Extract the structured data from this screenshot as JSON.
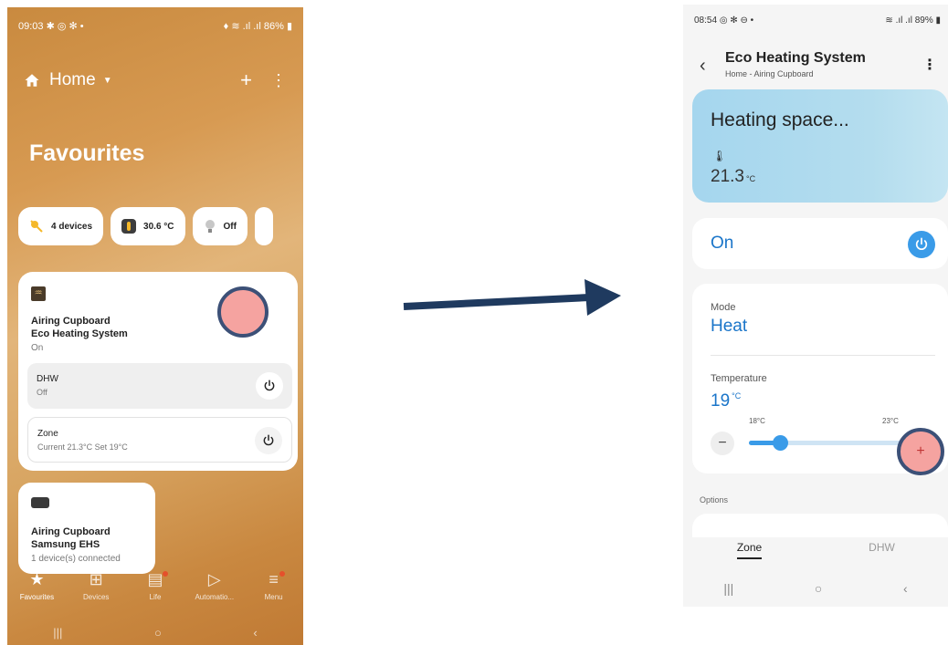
{
  "left": {
    "status": {
      "time": "09:03",
      "left_icons": "✱ ◎ ✻ •",
      "battery": "86%",
      "right_icons": "♦ ≋ .ıl .ıl"
    },
    "header": {
      "title": "Home",
      "add": "+",
      "more": "⋮"
    },
    "favourites_title": "Favourites",
    "chips": [
      {
        "label": "4 devices",
        "icon": "cloud-sun-icon",
        "color": "#f5b829"
      },
      {
        "label": "30.6 °C",
        "icon": "thermometer-icon",
        "color": "#f5b829"
      },
      {
        "label": "Off",
        "icon": "bulb-icon",
        "color": "#c7c7c7"
      }
    ],
    "card1": {
      "room": "Airing Cupboard",
      "device": "Eco Heating System",
      "state": "On",
      "rows": [
        {
          "title": "DHW",
          "subtitle": "Off"
        },
        {
          "title": "Zone",
          "subtitle": "Current 21.3°C Set 19°C"
        }
      ]
    },
    "card2": {
      "room": "Airing Cupboard",
      "device": "Samsung EHS",
      "status": "1 device(s) connected"
    },
    "nav": [
      {
        "label": "Favourites",
        "icon": "star-icon",
        "glyph": "★"
      },
      {
        "label": "Devices",
        "icon": "grid-icon",
        "glyph": "⊞"
      },
      {
        "label": "Life",
        "icon": "life-icon",
        "glyph": "▤"
      },
      {
        "label": "Automatio...",
        "icon": "play-icon",
        "glyph": "▷"
      },
      {
        "label": "Menu",
        "icon": "menu-icon",
        "glyph": "≡"
      }
    ],
    "sysnav": [
      "|||",
      "○",
      "‹"
    ]
  },
  "right": {
    "status": {
      "time": "08:54",
      "left_icons": "◎ ✻ ⊖ •",
      "battery": "89%",
      "right_icons": "≋ .ıl .ıl"
    },
    "header": {
      "back": "‹",
      "title": "Eco Heating System",
      "subtitle": "Home - Airing Cupboard",
      "more": "⋮"
    },
    "hero": {
      "title": "Heating space...",
      "temp": "21.3",
      "unit": "°C"
    },
    "power": {
      "label": "On"
    },
    "mode": {
      "label": "Mode",
      "value": "Heat"
    },
    "temperature": {
      "label": "Temperature",
      "value": "19",
      "unit": "°C",
      "min": "18°C",
      "max": "23°C",
      "setpoint_fraction": 0.2,
      "minus": "−",
      "plus": "+"
    },
    "options_label": "Options",
    "tabs": [
      {
        "label": "Zone",
        "active": true
      },
      {
        "label": "DHW",
        "active": false
      }
    ],
    "sysnav": [
      "|||",
      "○",
      "‹"
    ]
  },
  "colors": {
    "accent_blue": "#3a9be8",
    "marker_fill": "#f5a3a0",
    "marker_border": "#3c5077",
    "arrow": "#1f3a5f"
  }
}
